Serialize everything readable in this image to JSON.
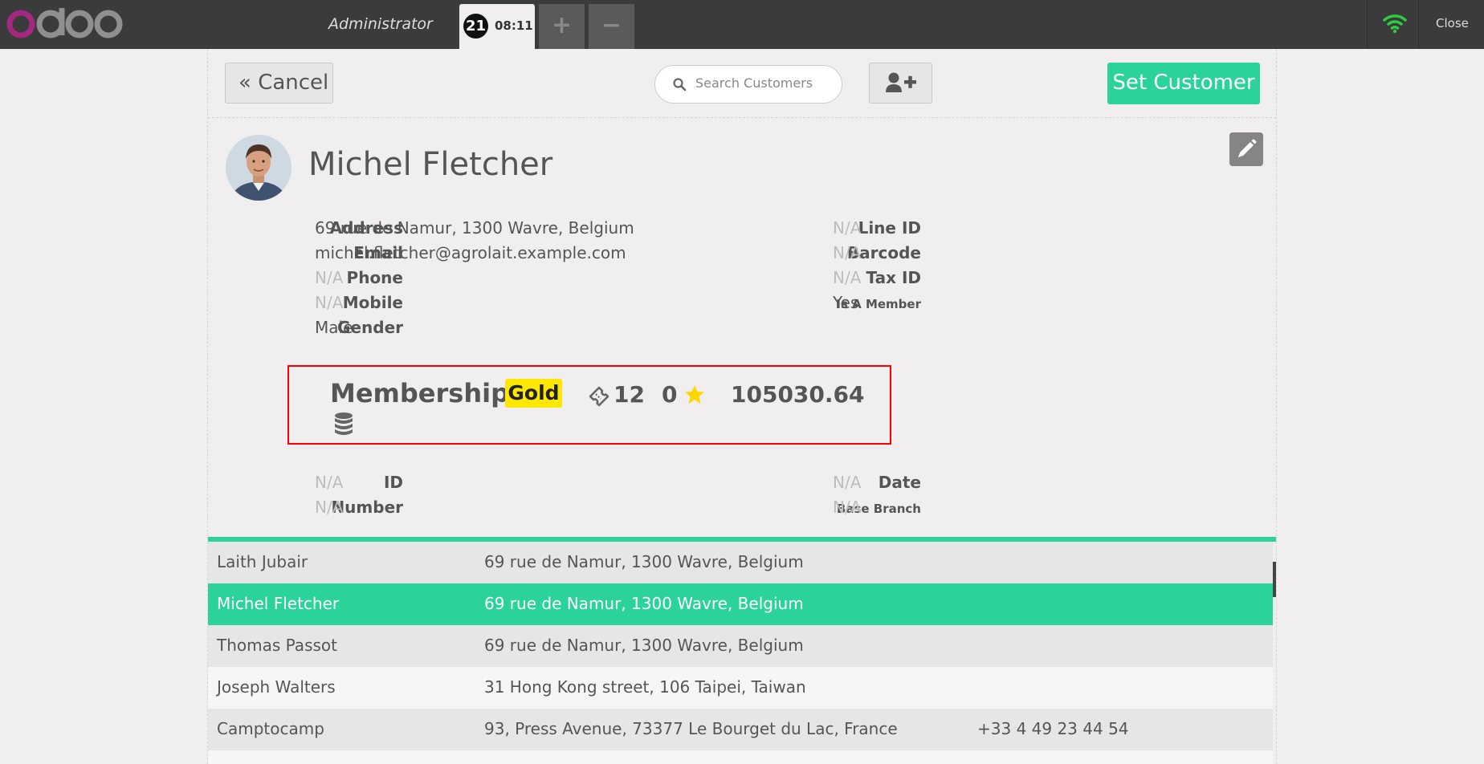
{
  "topbar": {
    "cashier": "Administrator",
    "order_number": "21",
    "order_time": "08:11",
    "add_order_label": "+",
    "remove_order_label": "−",
    "close_label": "Close",
    "logo_icon": "odoo-logo-icon",
    "wifi_color": "#2ecc40"
  },
  "toolbar": {
    "cancel_label": "Cancel",
    "search_placeholder": "Search Customers",
    "set_customer_label": "Set Customer",
    "accent_color": "#2bd39b"
  },
  "customer": {
    "name": "Michel Fletcher",
    "left_fields": [
      {
        "label": "Address",
        "value": "69 rue de Namur, 1300 Wavre, Belgium"
      },
      {
        "label": "Email",
        "value": "michel.fletcher@agrolait.example.com"
      },
      {
        "label": "Phone",
        "value": "N/A"
      },
      {
        "label": "Mobile",
        "value": "N/A"
      },
      {
        "label": "Gender",
        "value": "Male"
      }
    ],
    "right_fields": [
      {
        "label": "Line ID",
        "value": "N/A"
      },
      {
        "label": "Barcode",
        "value": "N/A"
      },
      {
        "label": "Tax ID",
        "value": "N/A"
      },
      {
        "label": "Is A Member",
        "value": "Yes"
      }
    ],
    "extra_left": [
      {
        "label": "ID",
        "value": "N/A"
      },
      {
        "label": "Number",
        "value": "N/A"
      }
    ],
    "extra_right": [
      {
        "label": "Date",
        "value": "N/A"
      },
      {
        "label": "Base Branch",
        "value": "N/A"
      }
    ]
  },
  "membership": {
    "title": "Membership",
    "level": "Gold",
    "level_color": "#ffe800",
    "visits": "12",
    "points": "0",
    "total_spent": "105030.64",
    "highlight_color": "#ff0000"
  },
  "customers": [
    {
      "name": "Laith Jubair",
      "address": "69 rue de Namur, 1300 Wavre, Belgium",
      "phone": ""
    },
    {
      "name": "Michel Fletcher",
      "address": "69 rue de Namur, 1300 Wavre, Belgium",
      "phone": ""
    },
    {
      "name": "Thomas Passot",
      "address": "69 rue de Namur, 1300 Wavre, Belgium",
      "phone": ""
    },
    {
      "name": "Joseph Walters",
      "address": "31 Hong Kong street, 106 Taipei, Taiwan",
      "phone": ""
    },
    {
      "name": "Camptocamp",
      "address": "93, Press Avenue, 73377 Le Bourget du Lac, France",
      "phone": "+33 4 49 23 44 54"
    },
    {
      "name": "",
      "address": "",
      "phone": ""
    }
  ]
}
